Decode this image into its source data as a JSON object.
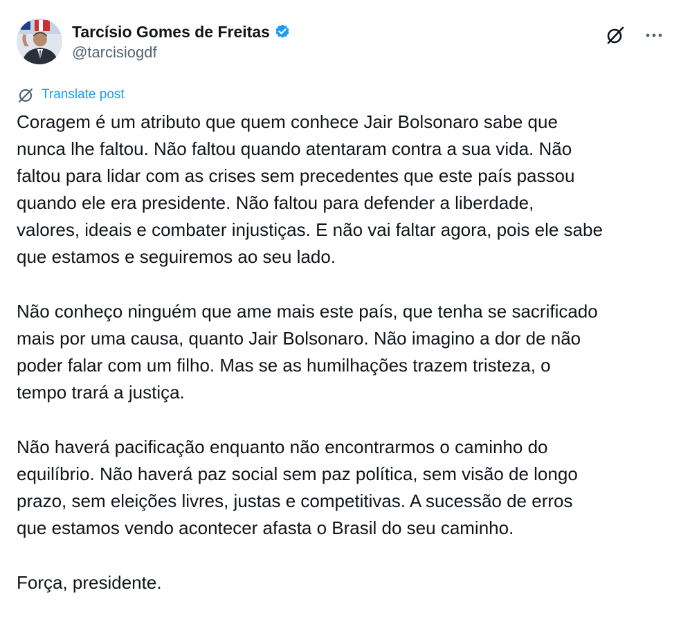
{
  "author": {
    "display_name": "Tarcísio Gomes de Freitas",
    "handle": "@tarcisiogdf",
    "verified": true
  },
  "icons": {
    "avatar": "avatar-photo",
    "verified": "verified-badge-icon",
    "grok": "grok-icon",
    "more": "more-options-icon",
    "translate": "translate-icon"
  },
  "colors": {
    "verified_blue": "#1d9bf0",
    "link_blue": "#1d9bf0",
    "text": "#0f1419",
    "secondary_text": "#536471"
  },
  "translate_label": "Translate post",
  "post": {
    "paragraphs": [
      {
        "lines": [
          "Coragem é um atributo que quem conhece Jair Bolsonaro sabe que",
          "nunca lhe faltou. Não faltou quando atentaram contra a sua vida. Não",
          "faltou para lidar com as crises sem precedentes que este país passou",
          "quando ele era presidente. Não faltou para defender a liberdade,",
          "valores, ideais e combater injustiças. E não vai faltar agora, pois ele sabe",
          "que estamos e seguiremos ao seu lado."
        ]
      },
      {
        "lines": [
          "Não conheço ninguém que ame mais este país, que tenha se sacrificado",
          "mais por uma causa, quanto Jair Bolsonaro. Não imagino a dor de não",
          "poder falar com um filho. Mas se as humilhações trazem tristeza, o",
          "tempo trará a justiça."
        ]
      },
      {
        "lines": [
          "Não haverá pacificação enquanto não encontrarmos o caminho do",
          "equilíbrio. Não haverá paz social sem paz política, sem visão de longo",
          "prazo, sem eleições livres, justas e competitivas. A sucessão de erros",
          "que estamos vendo acontecer afasta o Brasil do seu caminho."
        ]
      },
      {
        "lines": [
          "Força, presidente."
        ]
      }
    ]
  }
}
